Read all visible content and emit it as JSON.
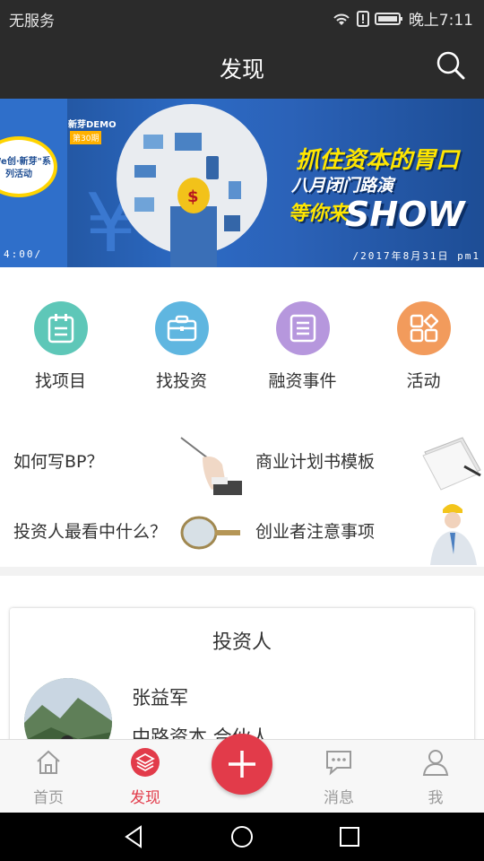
{
  "status_bar": {
    "carrier": "无服务",
    "time": "晚上7:11"
  },
  "header": {
    "title": "发现"
  },
  "banner": {
    "series_bubble": "\"We创·新芽\"系列活动",
    "brand": "新芽DEMO",
    "issue": "第30期",
    "headline": "抓住资本的胃口",
    "subline": "八月闭门路演",
    "tagline": "等你来",
    "show": "SHOW",
    "caption_left": "4:00/",
    "caption_right": "/2017年8月31日 pm1"
  },
  "categories": [
    {
      "label": "找项目",
      "color": "#5ec7b8",
      "icon": "clipboard-icon"
    },
    {
      "label": "找投资",
      "color": "#5fb6e0",
      "icon": "briefcase-icon"
    },
    {
      "label": "融资事件",
      "color": "#b697dd",
      "icon": "list-icon"
    },
    {
      "label": "活动",
      "color": "#f29b5c",
      "icon": "grid-icon"
    }
  ],
  "quick_links": [
    {
      "label": "如何写BP？",
      "icon": "pen-hand-illustration"
    },
    {
      "label": "商业计划书模板",
      "icon": "paper-stack-illustration"
    },
    {
      "label": "投资人最看中什么？",
      "icon": "magnifier-illustration"
    },
    {
      "label": "创业者注意事项",
      "icon": "businessman-illustration"
    }
  ],
  "investor_section": {
    "title": "投资人",
    "name": "张益军",
    "org": "中路资本 合伙人"
  },
  "tabs": [
    {
      "label": "首页",
      "icon": "home-icon"
    },
    {
      "label": "发现",
      "icon": "layers-icon",
      "active": true
    },
    {
      "label": "消息",
      "icon": "chat-icon"
    },
    {
      "label": "我",
      "icon": "user-icon"
    }
  ],
  "colors": {
    "accent": "#e23b4a",
    "dark_bar": "#2b2b2b",
    "tab_inactive": "#9a9a9a"
  }
}
